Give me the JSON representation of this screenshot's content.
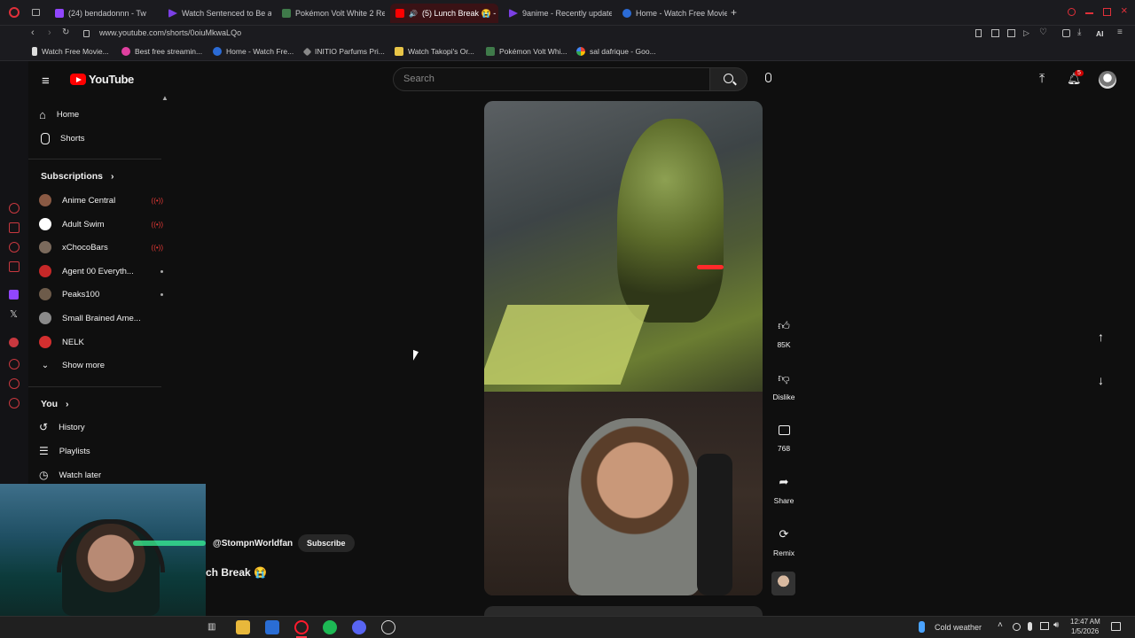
{
  "browser": {
    "tabs": [
      {
        "label": "(24) bendadonnn - Tw",
        "color": "#9146ff"
      },
      {
        "label": "Watch Sentenced to Be a",
        "color": "#7b3fe4"
      },
      {
        "label": "Pokémon Volt White 2 Re",
        "color": "#3f7a4a"
      },
      {
        "label": "(5) Lunch Break 😭 -",
        "color": "#ff0000"
      },
      {
        "label": "9anime - Recently update",
        "color": "#7b3fe4"
      },
      {
        "label": "Home - Watch Free Movie",
        "color": "#2b6bd6"
      }
    ],
    "url": "www.youtube.com/shorts/0oiuMkwaLQo",
    "ai_label": "AI",
    "bookmarks": [
      "Watch Free Movie...",
      "Best free streamin...",
      "Home - Watch Fre...",
      "INITIO Parfums Pri...",
      "Watch Takopi's Or...",
      "Pokémon Volt Whi...",
      "sal dafrique - Goo..."
    ]
  },
  "youtube": {
    "logo_text": "YouTube",
    "search_placeholder": "Search",
    "notification_count": "5"
  },
  "sidebar": {
    "home": "Home",
    "shorts": "Shorts",
    "subscriptions_header": "Subscriptions",
    "subscriptions": [
      {
        "name": "Anime Central",
        "status": "live",
        "color": "#8a5a44"
      },
      {
        "name": "Adult Swim",
        "status": "live",
        "color": "#ffffff"
      },
      {
        "name": "xChocoBars",
        "status": "live",
        "color": "#7b6a5c"
      },
      {
        "name": "Agent 00 Everyth...",
        "status": "new",
        "color": "#c62828"
      },
      {
        "name": "Peaks100",
        "status": "new",
        "color": "#6d5b4a"
      },
      {
        "name": "Small Brained Ame...",
        "status": "",
        "color": "#8a8a8a"
      },
      {
        "name": "NELK",
        "status": "",
        "color": "#d32f2f"
      }
    ],
    "show_more": "Show more",
    "you_header": "You",
    "history": "History",
    "playlists": "Playlists",
    "watch_later": "Watch later"
  },
  "short": {
    "channel": "@StompnWorldfan",
    "subscribe": "Subscribe",
    "title": "ch Break 😭",
    "likes": "85K",
    "dislike": "Dislike",
    "comments": "768",
    "share": "Share",
    "remix": "Remix"
  },
  "taskbar": {
    "weather": "Cold weather",
    "time": "12:47 AM",
    "date": "1/5/2026"
  }
}
